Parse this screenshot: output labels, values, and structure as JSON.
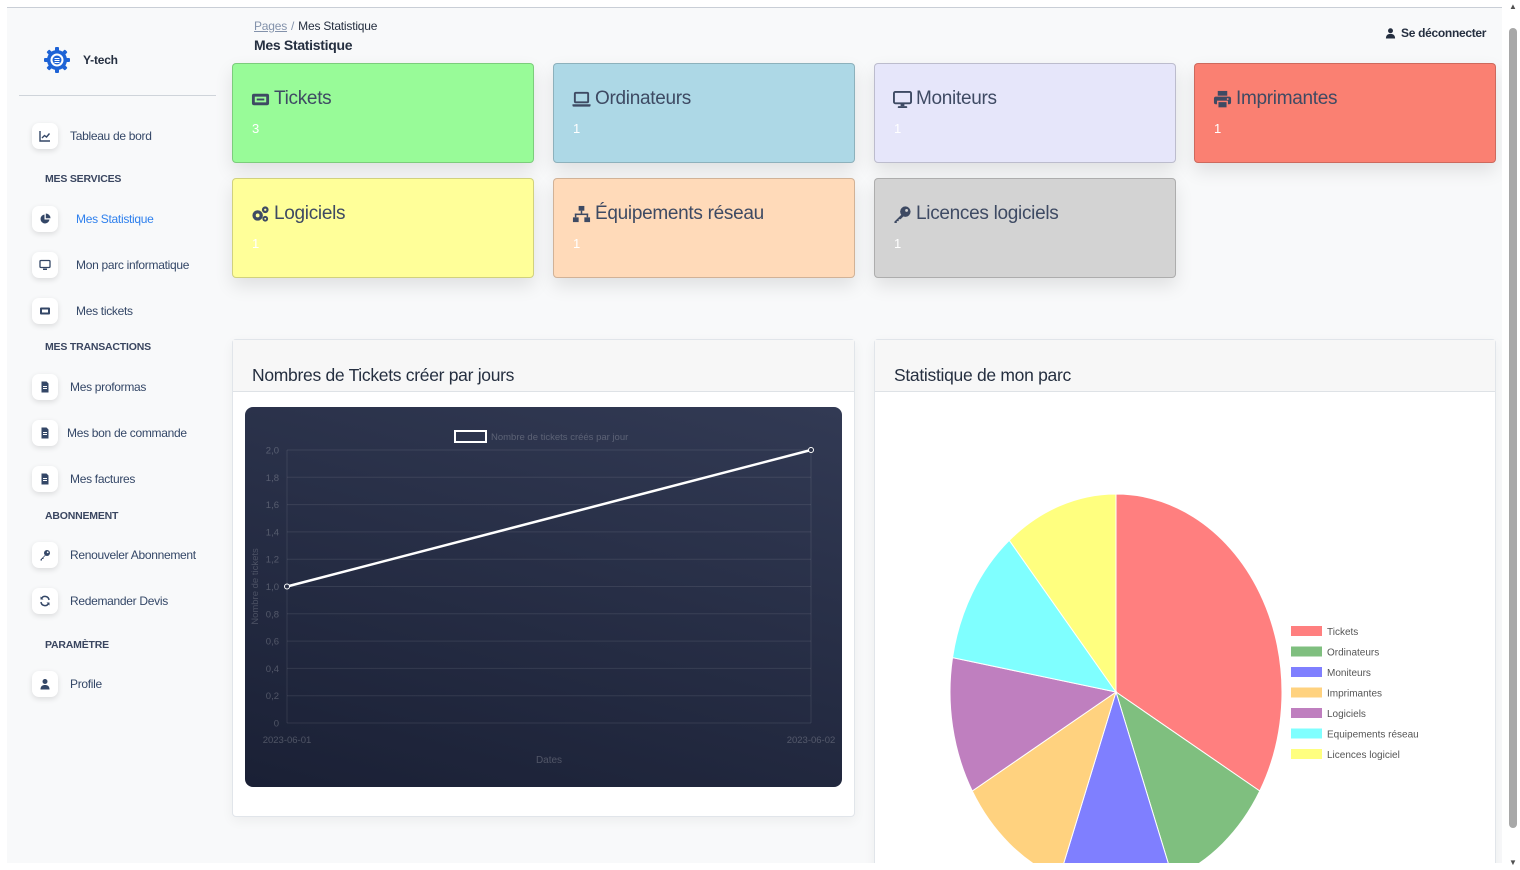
{
  "app": {
    "name": "Y-tech"
  },
  "breadcrumb": {
    "root": "Pages",
    "separator": "/",
    "current": "Mes Statistique"
  },
  "page_title": "Mes Statistique",
  "header": {
    "logout_label": "Se déconnecter"
  },
  "sidebar": {
    "items": [
      {
        "label": "Tableau de bord",
        "icon": "chart-line-icon"
      },
      {
        "label": "Mes Statistique",
        "icon": "pie-chart-icon",
        "active": true
      },
      {
        "label": "Mon parc informatique",
        "icon": "desktop-icon"
      },
      {
        "label": "Mes tickets",
        "icon": "ticket-icon"
      },
      {
        "label": "Mes proformas",
        "icon": "document-icon"
      },
      {
        "label": "Mes bon de commande",
        "icon": "document-icon"
      },
      {
        "label": "Mes factures",
        "icon": "document-icon"
      },
      {
        "label": "Renouveler Abonnement",
        "icon": "key-icon"
      },
      {
        "label": "Redemander Devis",
        "icon": "refresh-icon"
      },
      {
        "label": "Profile",
        "icon": "user-icon"
      }
    ],
    "sections": {
      "services": "MES SERVICES",
      "transactions": "MES TRANSACTIONS",
      "abonnement": "ABONNEMENT",
      "parametre": "PARAMÈTRE"
    }
  },
  "cards": [
    {
      "title": "Tickets",
      "value": "3",
      "color": "#98fb98",
      "icon": "ticket-icon"
    },
    {
      "title": "Ordinateurs",
      "value": "1",
      "color": "#add8e6",
      "icon": "laptop-icon"
    },
    {
      "title": "Moniteurs",
      "value": "1",
      "color": "#e6e6fa",
      "icon": "monitor-icon"
    },
    {
      "title": "Imprimantes",
      "value": "1",
      "color": "#fa8072",
      "icon": "printer-icon"
    },
    {
      "title": "Logiciels",
      "value": "1",
      "color": "#ffff99",
      "icon": "gears-icon"
    },
    {
      "title": "Équipements réseau",
      "value": "1",
      "color": "#ffdab9",
      "icon": "network-icon"
    },
    {
      "title": "Licences logiciels",
      "value": "1",
      "color": "#d3d3d3",
      "icon": "key-icon"
    }
  ],
  "line_panel": {
    "title": "Nombres de Tickets créer par jours"
  },
  "pie_panel": {
    "title": "Statistique de mon parc"
  },
  "chart_data": [
    {
      "type": "line",
      "legend": "Nombre de tickets créés par jour",
      "x": [
        "2023-06-01",
        "2023-06-02"
      ],
      "series": [
        {
          "name": "Nombre de tickets créés par jour",
          "values": [
            1,
            2
          ]
        }
      ],
      "xlabel": "Dates",
      "ylabel": "Nombre de tickets",
      "ylim": [
        0,
        2
      ],
      "yticks": [
        "0",
        "0,2",
        "0,4",
        "0,6",
        "0,8",
        "1,0",
        "1,2",
        "1,4",
        "1,6",
        "1,8",
        "2,0"
      ],
      "grid": true,
      "line_color": "#ffffff",
      "background": "#262d45"
    },
    {
      "type": "pie",
      "categories": [
        "Tickets",
        "Ordinateurs",
        "Moniteurs",
        "Imprimantes",
        "Logiciels",
        "Equipements réseau",
        "Licences logiciel"
      ],
      "values": [
        3,
        1,
        1,
        1,
        1,
        1,
        1
      ],
      "colors": [
        "#ff7f7f",
        "#7fbf7f",
        "#7f7fff",
        "#ffd27f",
        "#bf7fbf",
        "#7fffff",
        "#ffff7f"
      ],
      "legend_position": "right"
    }
  ]
}
